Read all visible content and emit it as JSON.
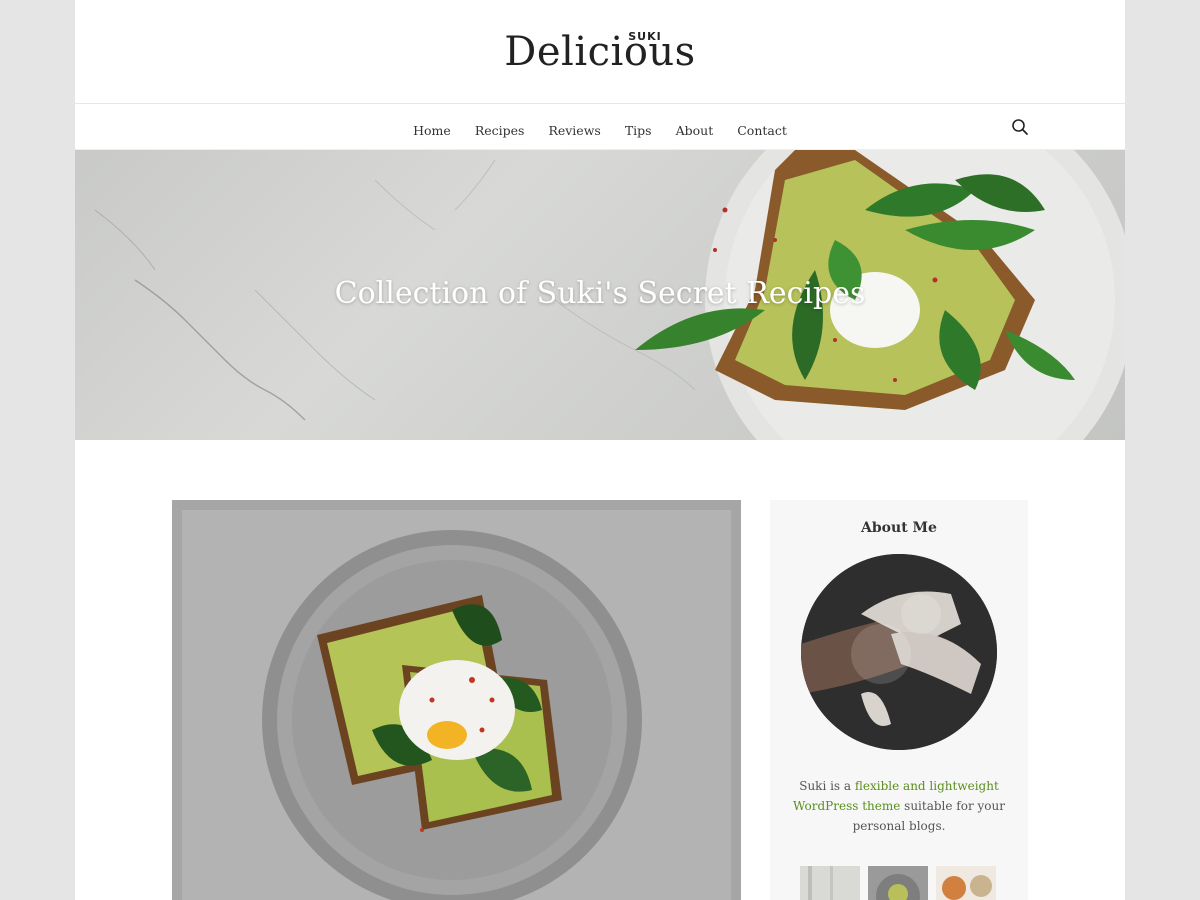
{
  "site": {
    "logo_small": "SUKI",
    "logo_main": "Delicious"
  },
  "nav": {
    "items": [
      {
        "label": "Home"
      },
      {
        "label": "Recipes"
      },
      {
        "label": "Reviews"
      },
      {
        "label": "Tips"
      },
      {
        "label": "About"
      },
      {
        "label": "Contact"
      }
    ],
    "search_icon": "search-icon"
  },
  "hero": {
    "title": "Collection of Suki's Secret Recipes"
  },
  "sidebar": {
    "title": "About Me",
    "about_prefix": "Suki is a",
    "link1": "flexible and lightweight",
    "link2": "WordPress theme",
    "about_suffix": "suitable for your personal blogs."
  },
  "colors": {
    "accent": "#5a8f1b",
    "background": "#e5e5e5",
    "hero_text": "#ffffff"
  }
}
